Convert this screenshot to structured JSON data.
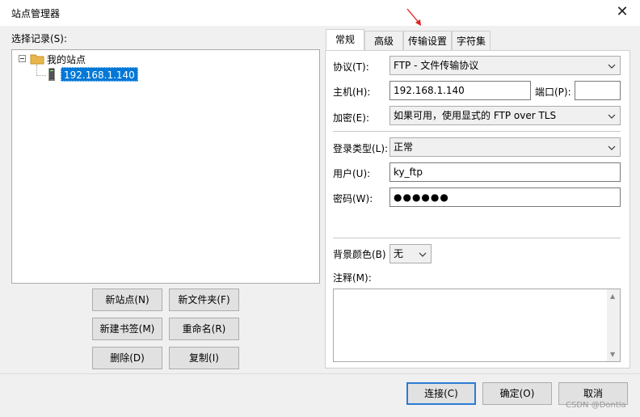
{
  "window": {
    "title": "站点管理器"
  },
  "left": {
    "select_label": "选择记录(S):",
    "tree": {
      "folder": "我的站点",
      "site": "192.168.1.140"
    },
    "buttons": {
      "new_site": "新站点(N)",
      "new_folder": "新文件夹(F)",
      "new_bookmark": "新建书签(M)",
      "rename": "重命名(R)",
      "delete": "删除(D)",
      "copy": "复制(I)"
    }
  },
  "tabs": [
    "常规",
    "高级",
    "传输设置",
    "字符集"
  ],
  "general": {
    "protocol_label": "协议(T):",
    "protocol_value": "FTP - 文件传输协议",
    "host_label": "主机(H):",
    "host_value": "192.168.1.140",
    "port_label": "端口(P):",
    "port_value": "",
    "encryption_label": "加密(E):",
    "encryption_value": "如果可用，使用显式的 FTP over TLS",
    "logon_label": "登录类型(L):",
    "logon_value": "正常",
    "user_label": "用户(U):",
    "user_value": "ky_ftp",
    "password_label": "密码(W):",
    "password_value": "●●●●●●",
    "bgcolor_label": "背景颜色(B)",
    "bgcolor_value": "无",
    "comments_label": "注释(M):"
  },
  "footer": {
    "connect": "连接(C)",
    "ok": "确定(O)",
    "cancel": "取消"
  },
  "watermark": "CSDN @Dontla",
  "colors": {
    "selection": "#0078d7",
    "folder": "#e8b64a",
    "arrow": "#e0201c"
  }
}
